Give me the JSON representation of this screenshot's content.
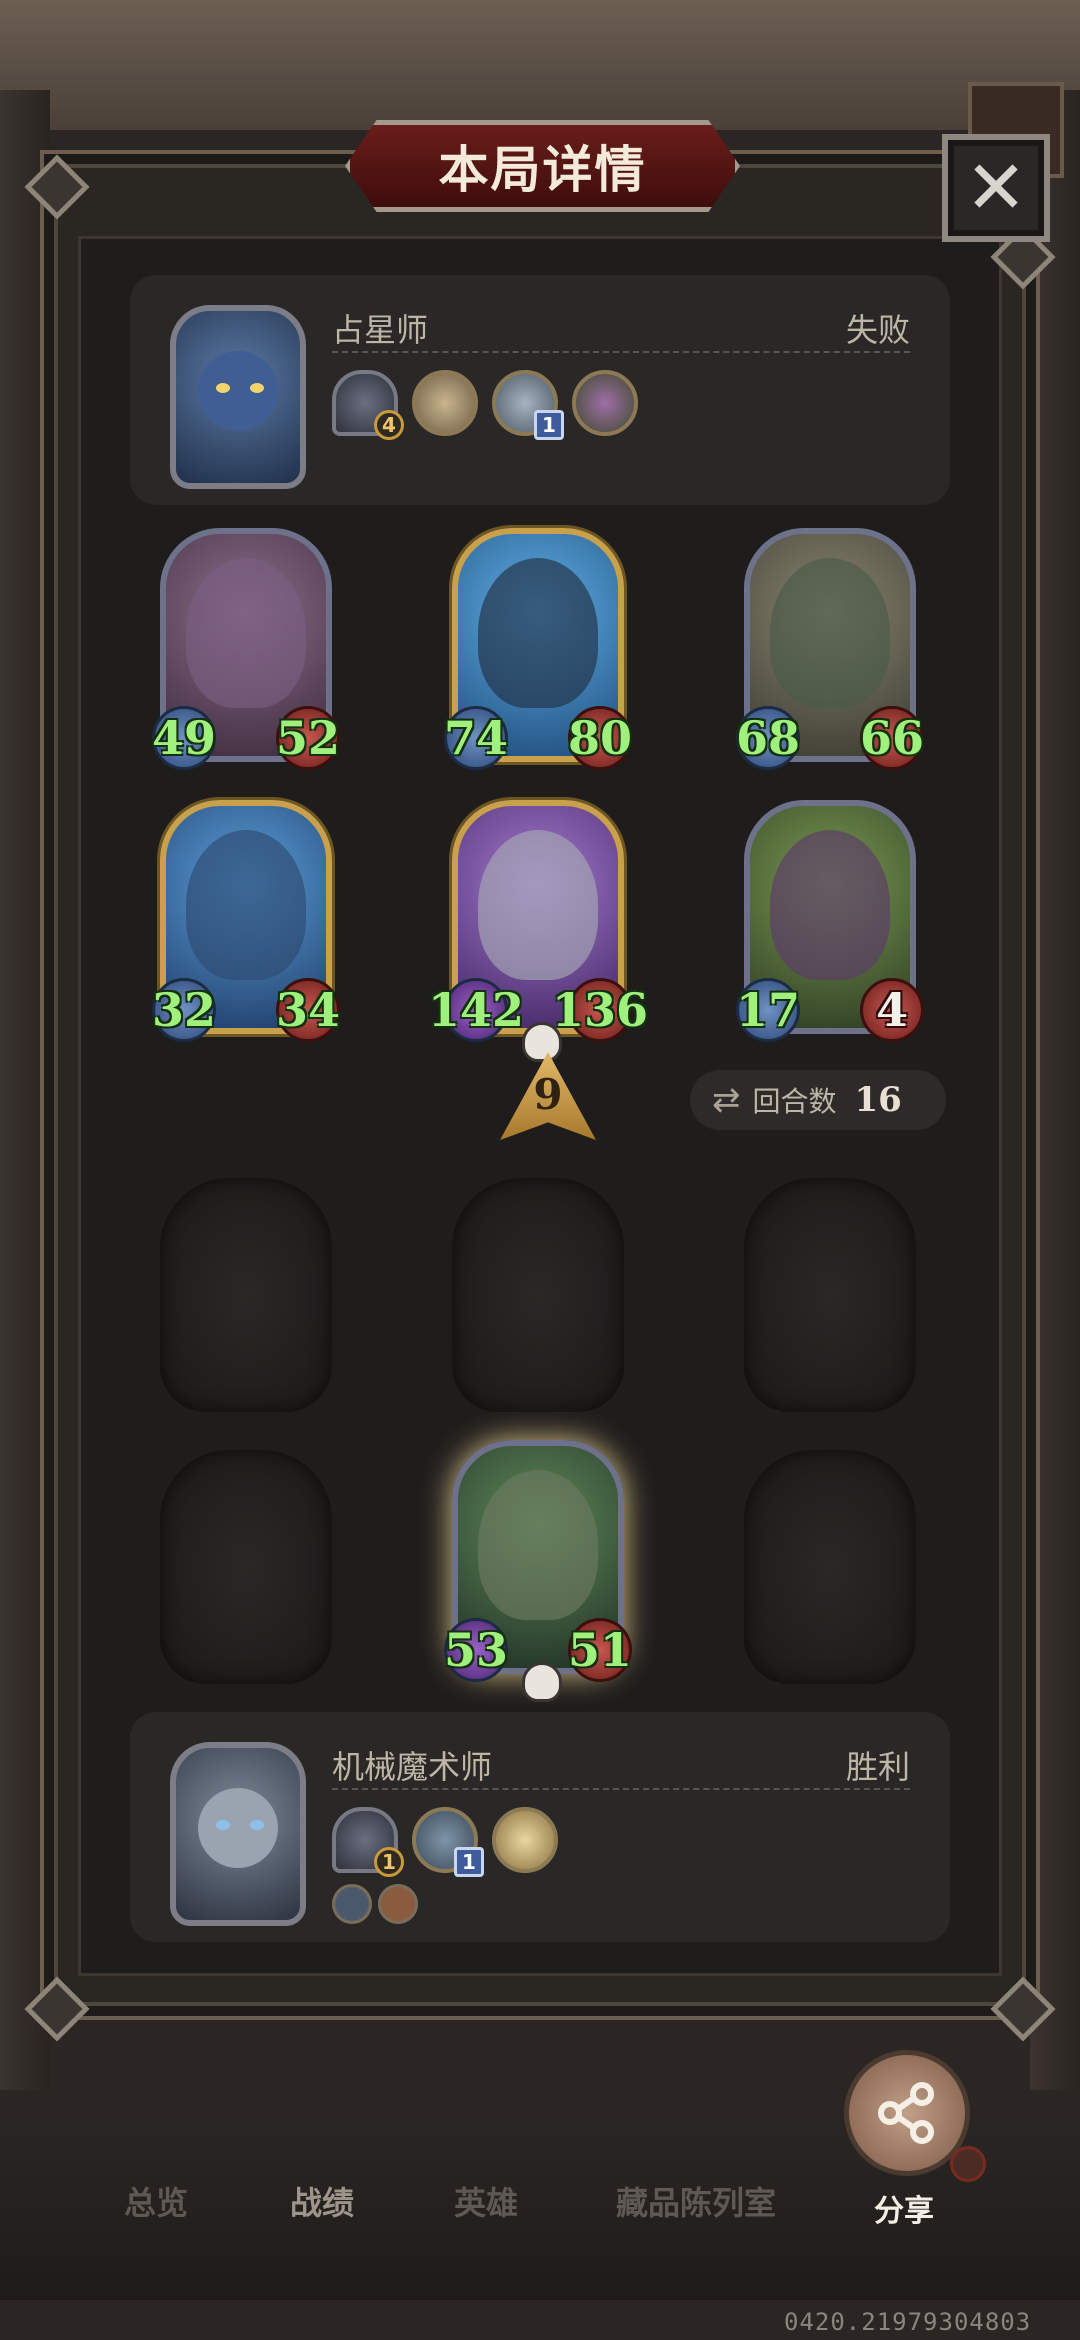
{
  "title": "本局详情",
  "close_icon": "✕",
  "top_player": {
    "name": "占星师",
    "result": "失败",
    "hero_icon": "astrologer-hero-icon",
    "items": [
      {
        "type": "tower",
        "badge": "4"
      },
      {
        "type": "scroll",
        "badge": ""
      },
      {
        "type": "spell",
        "badge": "1"
      },
      {
        "type": "box",
        "badge": ""
      }
    ]
  },
  "opponent_board": [
    {
      "attack": "49",
      "health": "52",
      "frame": "silver",
      "art_color": "#7b5d82"
    },
    {
      "attack": "74",
      "health": "80",
      "frame": "gold",
      "art_color": "#3e7fc4"
    },
    {
      "attack": "68",
      "health": "66",
      "frame": "silver",
      "art_color": "#5f6a56"
    },
    {
      "attack": "32",
      "health": "34",
      "frame": "gold",
      "art_color": "#3e6fa8"
    },
    {
      "attack": "142",
      "health": "136",
      "frame": "gold",
      "art_color": "#7d4d9a"
    },
    {
      "attack": "17",
      "health": "4",
      "frame": "silver",
      "art_color": "#6b8a3a"
    }
  ],
  "tier": "9",
  "rounds": {
    "label": "回合数",
    "value": "16"
  },
  "player_board": [
    {
      "attack": "53",
      "health": "51",
      "frame": "silver",
      "art_color": "#3d6a4a"
    }
  ],
  "bottom_player": {
    "name": "机械魔术师",
    "result": "胜利",
    "hero_icon": "mech-magician-hero-icon",
    "items": [
      {
        "type": "tower",
        "badge": "1"
      },
      {
        "type": "spell",
        "badge": "1"
      },
      {
        "type": "bag",
        "badge": ""
      }
    ]
  },
  "nav": {
    "tabs": [
      "总览",
      "战绩",
      "英雄",
      "藏品陈列室"
    ],
    "active": "战绩",
    "share_label": "分享"
  },
  "build_number": "0420.21979304803"
}
